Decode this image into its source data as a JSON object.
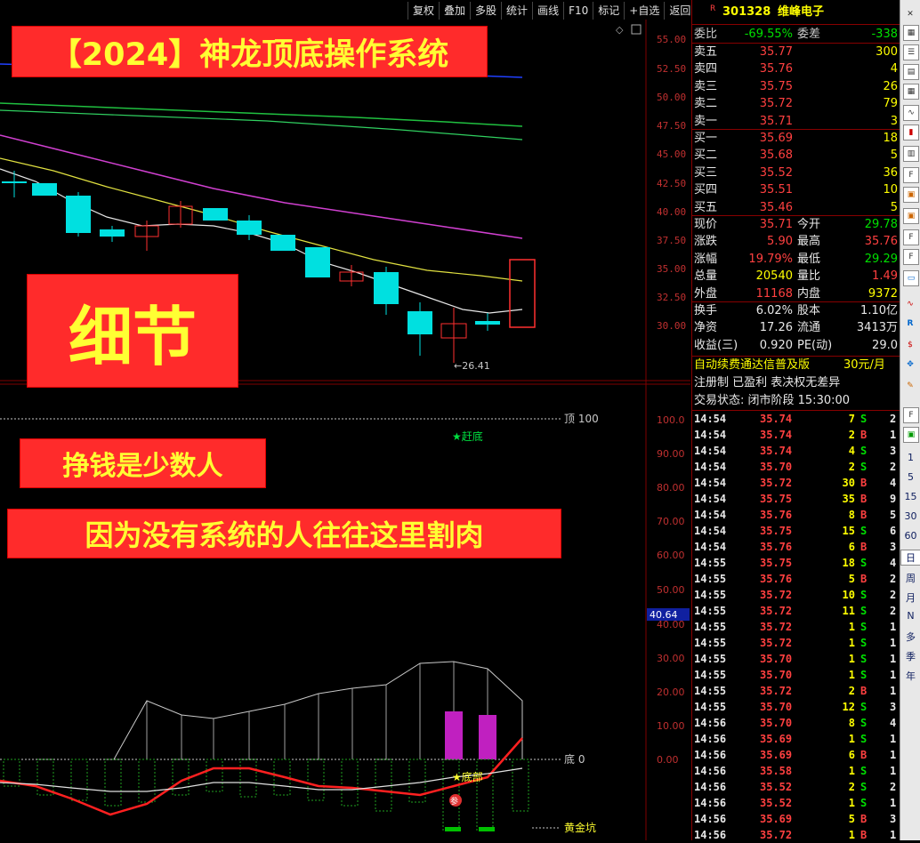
{
  "toolbar": [
    "复权",
    "叠加",
    "多股",
    "统计",
    "画线",
    "F10",
    "标记",
    "+自选",
    "返回"
  ],
  "price_axis": [
    "55.00",
    "52.50",
    "50.00",
    "47.50",
    "45.00",
    "42.50",
    "40.00",
    "37.50",
    "35.00",
    "32.50",
    "30.00"
  ],
  "ind_axis": [
    "100.0",
    "90.00",
    "80.00",
    "70.00",
    "60.00",
    "50.00",
    "40.00",
    "30.00",
    "20.00",
    "10.00",
    "0.00"
  ],
  "cursor_value": "40.64",
  "low_marker": "26.41",
  "ind_labels": {
    "top": "顶 100",
    "bottom": "底 0",
    "pit": "黄金坑",
    "chase": "★赶底",
    "bottom_star": "★底部",
    "bottom_badge": "参"
  },
  "overlays": {
    "title": "【2024】神龙顶底操作系统",
    "detail": "细节",
    "minority": "挣钱是少数人",
    "reason": "因为没有系统的人往往这里割肉"
  },
  "stock": {
    "marker": "R",
    "code": "301328",
    "name": "维峰电子"
  },
  "ratio": {
    "label1": "委比",
    "v1": "-69.55%",
    "label2": "委差",
    "v2": "-338"
  },
  "asks": [
    {
      "label": "卖五",
      "price": "35.77",
      "vol": "300"
    },
    {
      "label": "卖四",
      "price": "35.76",
      "vol": "4"
    },
    {
      "label": "卖三",
      "price": "35.75",
      "vol": "26"
    },
    {
      "label": "卖二",
      "price": "35.72",
      "vol": "79"
    },
    {
      "label": "卖一",
      "price": "35.71",
      "vol": "3"
    }
  ],
  "bids": [
    {
      "label": "买一",
      "price": "35.69",
      "vol": "18"
    },
    {
      "label": "买二",
      "price": "35.68",
      "vol": "5"
    },
    {
      "label": "买三",
      "price": "35.52",
      "vol": "36"
    },
    {
      "label": "买四",
      "price": "35.51",
      "vol": "10"
    },
    {
      "label": "买五",
      "price": "35.46",
      "vol": "5"
    }
  ],
  "quote": [
    {
      "l1": "现价",
      "v1": "35.71",
      "l2": "今开",
      "v2": "29.78"
    },
    {
      "l1": "涨跌",
      "v1": "5.90",
      "l2": "最高",
      "v2": "35.76"
    },
    {
      "l1": "涨幅",
      "v1": "19.79%",
      "l2": "最低",
      "v2": "29.29"
    },
    {
      "l1": "总量",
      "v1": "20540",
      "l2": "量比",
      "v2": "1.49"
    },
    {
      "l1": "外盘",
      "v1": "11168",
      "l2": "内盘",
      "v2": "9372"
    }
  ],
  "fund": [
    {
      "l1": "换手",
      "v1": "6.02%",
      "l2": "股本",
      "v2": "1.10亿"
    },
    {
      "l1": "净资",
      "v1": "17.26",
      "l2": "流通",
      "v2": "3413万"
    },
    {
      "l1": "收益(三)",
      "v1": "0.920",
      "l2": "PE(动)",
      "v2": "29.0"
    }
  ],
  "promo": {
    "text": "自动续费通达信普及版",
    "price": "30元/月"
  },
  "info1": "注册制 已盈利 表决权无差异",
  "info2": "交易状态: 闭市阶段 15:30:00",
  "ticks": [
    [
      "14:54",
      "35.74",
      "7",
      "S",
      "2"
    ],
    [
      "14:54",
      "35.74",
      "2",
      "B",
      "1"
    ],
    [
      "14:54",
      "35.74",
      "4",
      "S",
      "3"
    ],
    [
      "14:54",
      "35.70",
      "2",
      "S",
      "2"
    ],
    [
      "14:54",
      "35.72",
      "30",
      "B",
      "4"
    ],
    [
      "14:54",
      "35.75",
      "35",
      "B",
      "9"
    ],
    [
      "14:54",
      "35.76",
      "8",
      "B",
      "5"
    ],
    [
      "14:54",
      "35.75",
      "15",
      "S",
      "6"
    ],
    [
      "14:54",
      "35.76",
      "6",
      "B",
      "3"
    ],
    [
      "14:55",
      "35.75",
      "18",
      "S",
      "4"
    ],
    [
      "14:55",
      "35.76",
      "5",
      "B",
      "2"
    ],
    [
      "14:55",
      "35.72",
      "10",
      "S",
      "2"
    ],
    [
      "14:55",
      "35.72",
      "11",
      "S",
      "2"
    ],
    [
      "14:55",
      "35.72",
      "1",
      "S",
      "1"
    ],
    [
      "14:55",
      "35.72",
      "1",
      "S",
      "1"
    ],
    [
      "14:55",
      "35.70",
      "1",
      "S",
      "1"
    ],
    [
      "14:55",
      "35.70",
      "1",
      "S",
      "1"
    ],
    [
      "14:55",
      "35.72",
      "2",
      "B",
      "1"
    ],
    [
      "14:55",
      "35.70",
      "12",
      "S",
      "3"
    ],
    [
      "14:56",
      "35.70",
      "8",
      "S",
      "4"
    ],
    [
      "14:56",
      "35.69",
      "1",
      "S",
      "1"
    ],
    [
      "14:56",
      "35.69",
      "6",
      "B",
      "1"
    ],
    [
      "14:56",
      "35.58",
      "1",
      "S",
      "1"
    ],
    [
      "14:56",
      "35.52",
      "2",
      "S",
      "2"
    ],
    [
      "14:56",
      "35.52",
      "1",
      "S",
      "1"
    ],
    [
      "14:56",
      "35.69",
      "5",
      "B",
      "3"
    ],
    [
      "14:56",
      "35.72",
      "1",
      "B",
      "1"
    ]
  ],
  "side_text": [
    "1",
    "5",
    "15",
    "30",
    "60",
    "日",
    "周",
    "月",
    "N",
    "多",
    "季",
    "年"
  ],
  "colors": {
    "up": "#ff3030",
    "down": "#00e0e0",
    "bg": "#000000",
    "banner": "#ff2b2b",
    "banner_text": "#ffff33"
  }
}
